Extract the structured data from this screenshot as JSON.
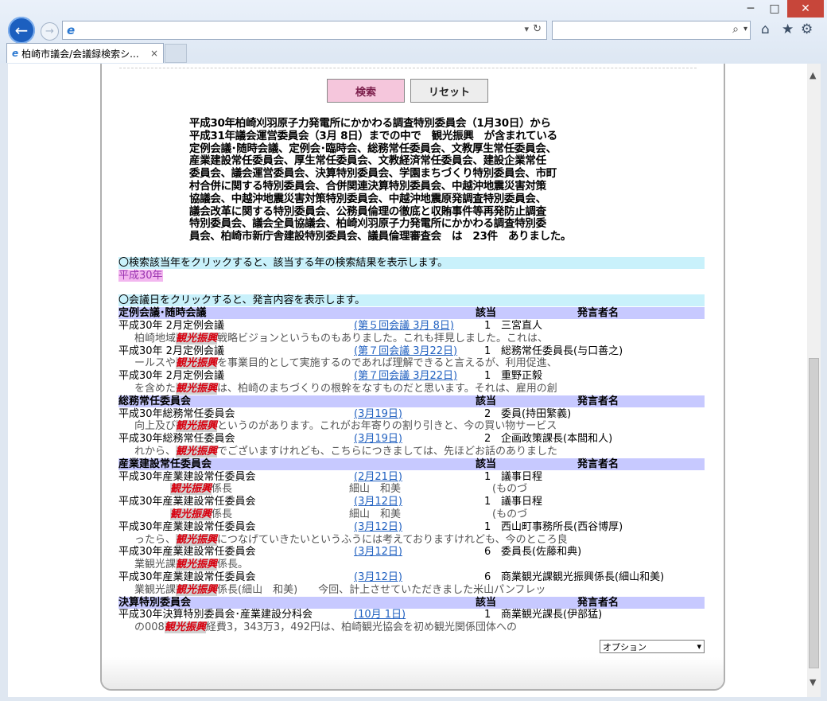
{
  "tab": {
    "title": "柏崎市議会/会議録検索シ...",
    "close": "×"
  },
  "chrome": {
    "min": "─",
    "max": "□",
    "close": "✕",
    "back": "←",
    "fwd": "→",
    "refresh": "↻",
    "dropdown": "▾",
    "search_icon": "⌕",
    "home": "⌂",
    "star": "★",
    "gear": "⚙"
  },
  "buttons": {
    "search": "検索",
    "reset": "リセット"
  },
  "summary": [
    "平成30年柏崎刈羽原子力発電所にかかわる調査特別委員会（1月30日）から",
    "平成31年議会運営委員会（3月 8日）までの中で　観光振興　が含まれている",
    "定例会議･随時会議、定例会･臨時会、総務常任委員会、文教厚生常任委員会、",
    "産業建設常任委員会、厚生常任委員会、文教経済常任委員会、建設企業常任",
    "委員会、議会運営委員会、決算特別委員会、学園まちづくり特別委員会、市町",
    "村合併に関する特別委員会、合併関連決算特別委員会、中越沖地震災害対策",
    "協議会、中越沖地震災害対策特別委員会、中越沖地震原発調査特別委員会、",
    "議会改革に関する特別委員会、公務員倫理の徹底と収賄事件等再発防止調査",
    "特別委員会、議会全員協議会、柏崎刈羽原子力発電所にかかわる調査特別委",
    "員会、柏崎市新庁舎建設特別委員会、議員倫理審査会　は　23件　ありました。"
  ],
  "year_notice": "〇検索該当年をクリックすると、該当する年の検索結果を表示します。",
  "year_link": "平成30年",
  "date_notice": "〇会議日をクリックすると、発言内容を表示します。",
  "keyword": "観光振興",
  "header_labels": {
    "gaito": "該当",
    "speaker": "発言者名"
  },
  "sections": [
    {
      "title": "定例会議･随時会議",
      "rows": [
        {
          "meeting": "平成30年 2月定例会議",
          "link": "(第５回会議 3月 8日)",
          "count": "1",
          "speaker": "三宮直人",
          "pre": "柏崎地域",
          "post": "戦略ビジョンというものもありました。これも拝見しました。これは、"
        },
        {
          "meeting": "平成30年 2月定例会議",
          "link": "(第７回会議 3月22日)",
          "count": "1",
          "speaker": "総務常任委員長(与口善之)",
          "pre": "ールスや",
          "post": "を事業目的として実施するのであれば理解できると言えるが、利用促進、"
        },
        {
          "meeting": "平成30年 2月定例会議",
          "link": "(第７回会議 3月22日)",
          "count": "1",
          "speaker": "重野正毅",
          "pre": "を含めた",
          "post": "は、柏崎のまちづくりの根幹をなすものだと思います。それは、雇用の創"
        }
      ]
    },
    {
      "title": "総務常任委員会",
      "rows": [
        {
          "meeting": "平成30年総務常任委員会",
          "link": "(3月19日)",
          "count": "2",
          "speaker": "委員(持田繁義)",
          "pre": "向上及び",
          "post": "というのがあります。これがお年寄りの割り引きと、今の買い物サービス"
        },
        {
          "meeting": "平成30年総務常任委員会",
          "link": "(3月19日)",
          "count": "2",
          "speaker": "企画政策課長(本間和人)",
          "pre": "れから、",
          "post": "でございますけれども、こちらにつきましては、先ほどお話のありました"
        }
      ]
    },
    {
      "title": "産業建設常任委員会",
      "rows": [
        {
          "meeting": "平成30年産業建設常任委員会",
          "link": "(2月21日)",
          "count": "1",
          "speaker": "議事日程",
          "pre": "",
          "post": "係長",
          "reply1": "細山　和美",
          "reply2": "(ものづ"
        },
        {
          "meeting": "平成30年産業建設常任委員会",
          "link": "(3月12日)",
          "count": "1",
          "speaker": "議事日程",
          "pre": "",
          "post": "係長",
          "reply1": "細山　和美",
          "reply2": "(ものづ"
        },
        {
          "meeting": "平成30年産業建設常任委員会",
          "link": "(3月12日)",
          "count": "1",
          "speaker": "西山町事務所長(西谷博厚)",
          "pre": "ったら、",
          "post": "につなげていきたいというふうには考えておりますけれども、今のところ良"
        },
        {
          "meeting": "平成30年産業建設常任委員会",
          "link": "(3月12日)",
          "count": "6",
          "speaker": "委員長(佐藤和典)",
          "pre": "業観光課",
          "post": "係長。"
        },
        {
          "meeting": "平成30年産業建設常任委員会",
          "link": "(3月12日)",
          "count": "6",
          "speaker": "商業観光課観光振興係長(細山和美)",
          "pre": "業観光課",
          "post": "係長(細山　和美)　　今回、計上させていただきました米山パンフレッ"
        }
      ]
    },
    {
      "title": "決算特別委員会",
      "rows": [
        {
          "meeting": "平成30年決算特別委員会･産業建設分科会",
          "link": "(10月 1日)",
          "count": "1",
          "speaker": "商業観光課長(伊部猛)",
          "pre": "の008",
          "post": "経費3，343万3，492円は、柏崎観光協会を初め観光関係団体への"
        }
      ]
    }
  ],
  "options": {
    "selected": "オプション",
    "arrow": "▾"
  },
  "colors": {
    "search_btn": "#f5c6dc",
    "section_bar": "#c7c9ff",
    "notice_bar": "#c9f1fb",
    "keyword": "#d8000f",
    "link": "#2060c0"
  }
}
